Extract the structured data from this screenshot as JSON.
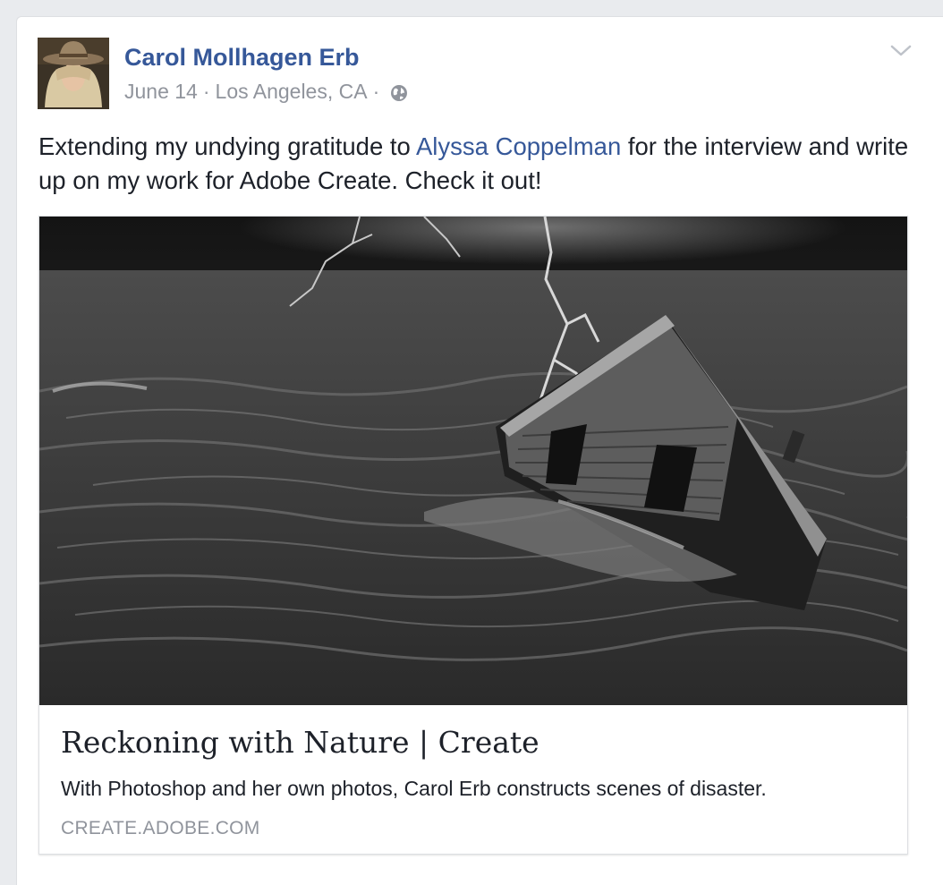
{
  "post": {
    "author": "Carol Mollhagen Erb",
    "date": "June 14",
    "separator": "·",
    "location": "Los Angeles, CA",
    "privacy_icon": "globe-icon",
    "menu_icon": "chevron-down-icon",
    "text_before": "Extending my undying gratitude to ",
    "mention": "Alyssa Coppelman",
    "text_after": " for the interview and write up on my work for Adobe Create. Check it out!"
  },
  "link_preview": {
    "image": "sinking-house-storm-photo",
    "title": "Reckoning with Nature | Create",
    "description": "With Photoshop and her own photos, Carol Erb constructs scenes of disaster.",
    "domain": "CREATE.ADOBE.COM"
  },
  "colors": {
    "background": "#e9ebee",
    "link_blue": "#365899",
    "text": "#1d2129",
    "meta_gray": "#90949c"
  }
}
